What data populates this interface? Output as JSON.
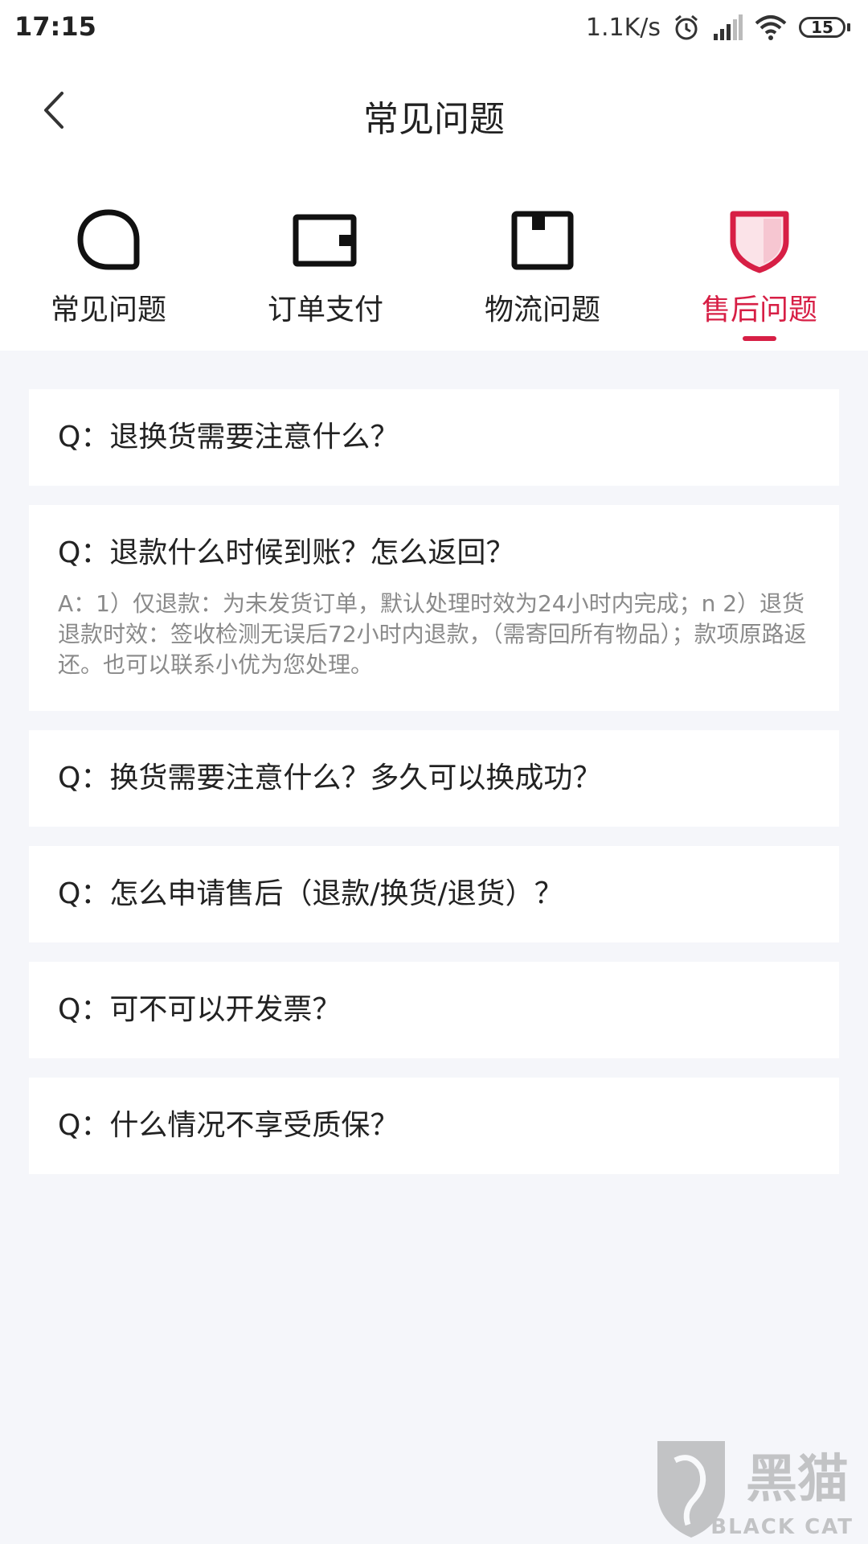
{
  "status_bar": {
    "time": "17:15",
    "speed": "1.1K/s",
    "battery": "15",
    "icons": [
      "alarm-icon",
      "signal-icon",
      "wifi-icon",
      "battery-icon"
    ]
  },
  "header": {
    "title": "常见问题",
    "back_icon": "chevron-left-icon"
  },
  "tabs": [
    {
      "label": "常见问题",
      "icon": "chat-bubble-icon",
      "active": false
    },
    {
      "label": "订单支付",
      "icon": "wallet-icon",
      "active": false
    },
    {
      "label": "物流问题",
      "icon": "package-icon",
      "active": false
    },
    {
      "label": "售后问题",
      "icon": "shield-icon",
      "active": true
    }
  ],
  "accent_color": "#d71f45",
  "faqs": [
    {
      "q": "Q：退换货需要注意什么？"
    },
    {
      "q": "Q：退款什么时候到账？怎么返回？",
      "a": "A：1）仅退款：为未发货订单，默认处理时效为24小时内完成；n 2）退货退款时效：签收检测无误后72小时内退款，（需寄回所有物品）；款项原路返还。也可以联系小优为您处理。"
    },
    {
      "q": "Q：换货需要注意什么？多久可以换成功？"
    },
    {
      "q": "Q：怎么申请售后（退款/换货/退货）？"
    },
    {
      "q": "Q：可不可以开发票？"
    },
    {
      "q": "Q：什么情况不享受质保？"
    }
  ],
  "watermark": {
    "main": "黑猫",
    "sub": "BLACK CAT"
  }
}
